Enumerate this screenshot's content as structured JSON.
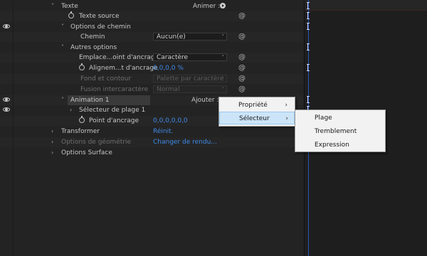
{
  "rows": {
    "texte": "Texte",
    "animer_label": "Animer :",
    "texte_source": "Texte source",
    "options_chemin": "Options de chemin",
    "chemin": "Chemin",
    "chemin_value": "Aucun(e)",
    "autres_options": "Autres options",
    "emplacement": "Emplace...oint d'ancrage",
    "emplacement_value": "Caractère",
    "alignement": "Alignem...t d'ancrage",
    "alignement_value": "0,0,0,0 %",
    "fond_contour": "Fond et contour",
    "fond_contour_value": "Palette par caractère",
    "fusion": "Fusion intercaractère",
    "fusion_value": "Normal",
    "animation1": "Animation 1",
    "ajouter_label": "Ajouter :",
    "selecteur_plage": "Sélecteur de plage 1",
    "point_ancrage": "Point d'ancrage",
    "point_ancrage_value": "0,0,0,0,0,0",
    "transformer": "Transformer",
    "transformer_link": "Réinit.",
    "options_geometrie": "Options de géométrie",
    "options_geometrie_link": "Changer de rendu...",
    "options_surface": "Options Surface"
  },
  "menu1": {
    "items": [
      "Propriété",
      "Sélecteur"
    ]
  },
  "menu2": {
    "items": [
      "Plage",
      "Tremblement",
      "Expression"
    ]
  },
  "colors": {
    "accent_blue": "#3f8ae8",
    "menu_highlight": "#cce4f7"
  }
}
